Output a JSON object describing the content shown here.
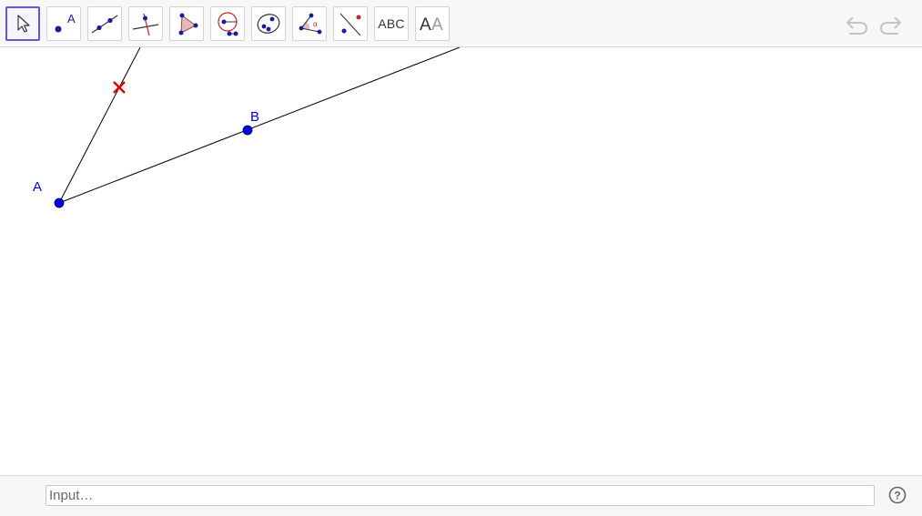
{
  "toolbar": {
    "tools": [
      {
        "name": "move-tool",
        "icon": "cursor-arrow-icon"
      },
      {
        "name": "point-tool",
        "icon": "point-icon",
        "label": "A"
      },
      {
        "name": "line-tool",
        "icon": "line-through-points-icon"
      },
      {
        "name": "perpendicular-line-tool",
        "icon": "perpendicular-line-icon"
      },
      {
        "name": "polygon-tool",
        "icon": "polygon-icon"
      },
      {
        "name": "circle-tool",
        "icon": "circle-center-point-icon"
      },
      {
        "name": "conic-tool",
        "icon": "ellipse-icon"
      },
      {
        "name": "angle-tool",
        "icon": "angle-icon",
        "label": "α"
      },
      {
        "name": "reflect-tool",
        "icon": "reflect-about-line-icon"
      },
      {
        "name": "text-tool",
        "label": "ABC"
      },
      {
        "name": "style-tool",
        "label": "AA"
      }
    ],
    "selected": "move-tool",
    "undo_icon": "undo-icon",
    "redo_icon": "redo-icon"
  },
  "graphics": {
    "points": [
      {
        "label": "A",
        "color": "#0000e6"
      },
      {
        "label": "B",
        "color": "#0000e6"
      }
    ],
    "marker_color": "#e60000",
    "line_color": "#000000"
  },
  "input_bar": {
    "placeholder": "Input…",
    "value": "",
    "help_icon": "help-icon"
  }
}
